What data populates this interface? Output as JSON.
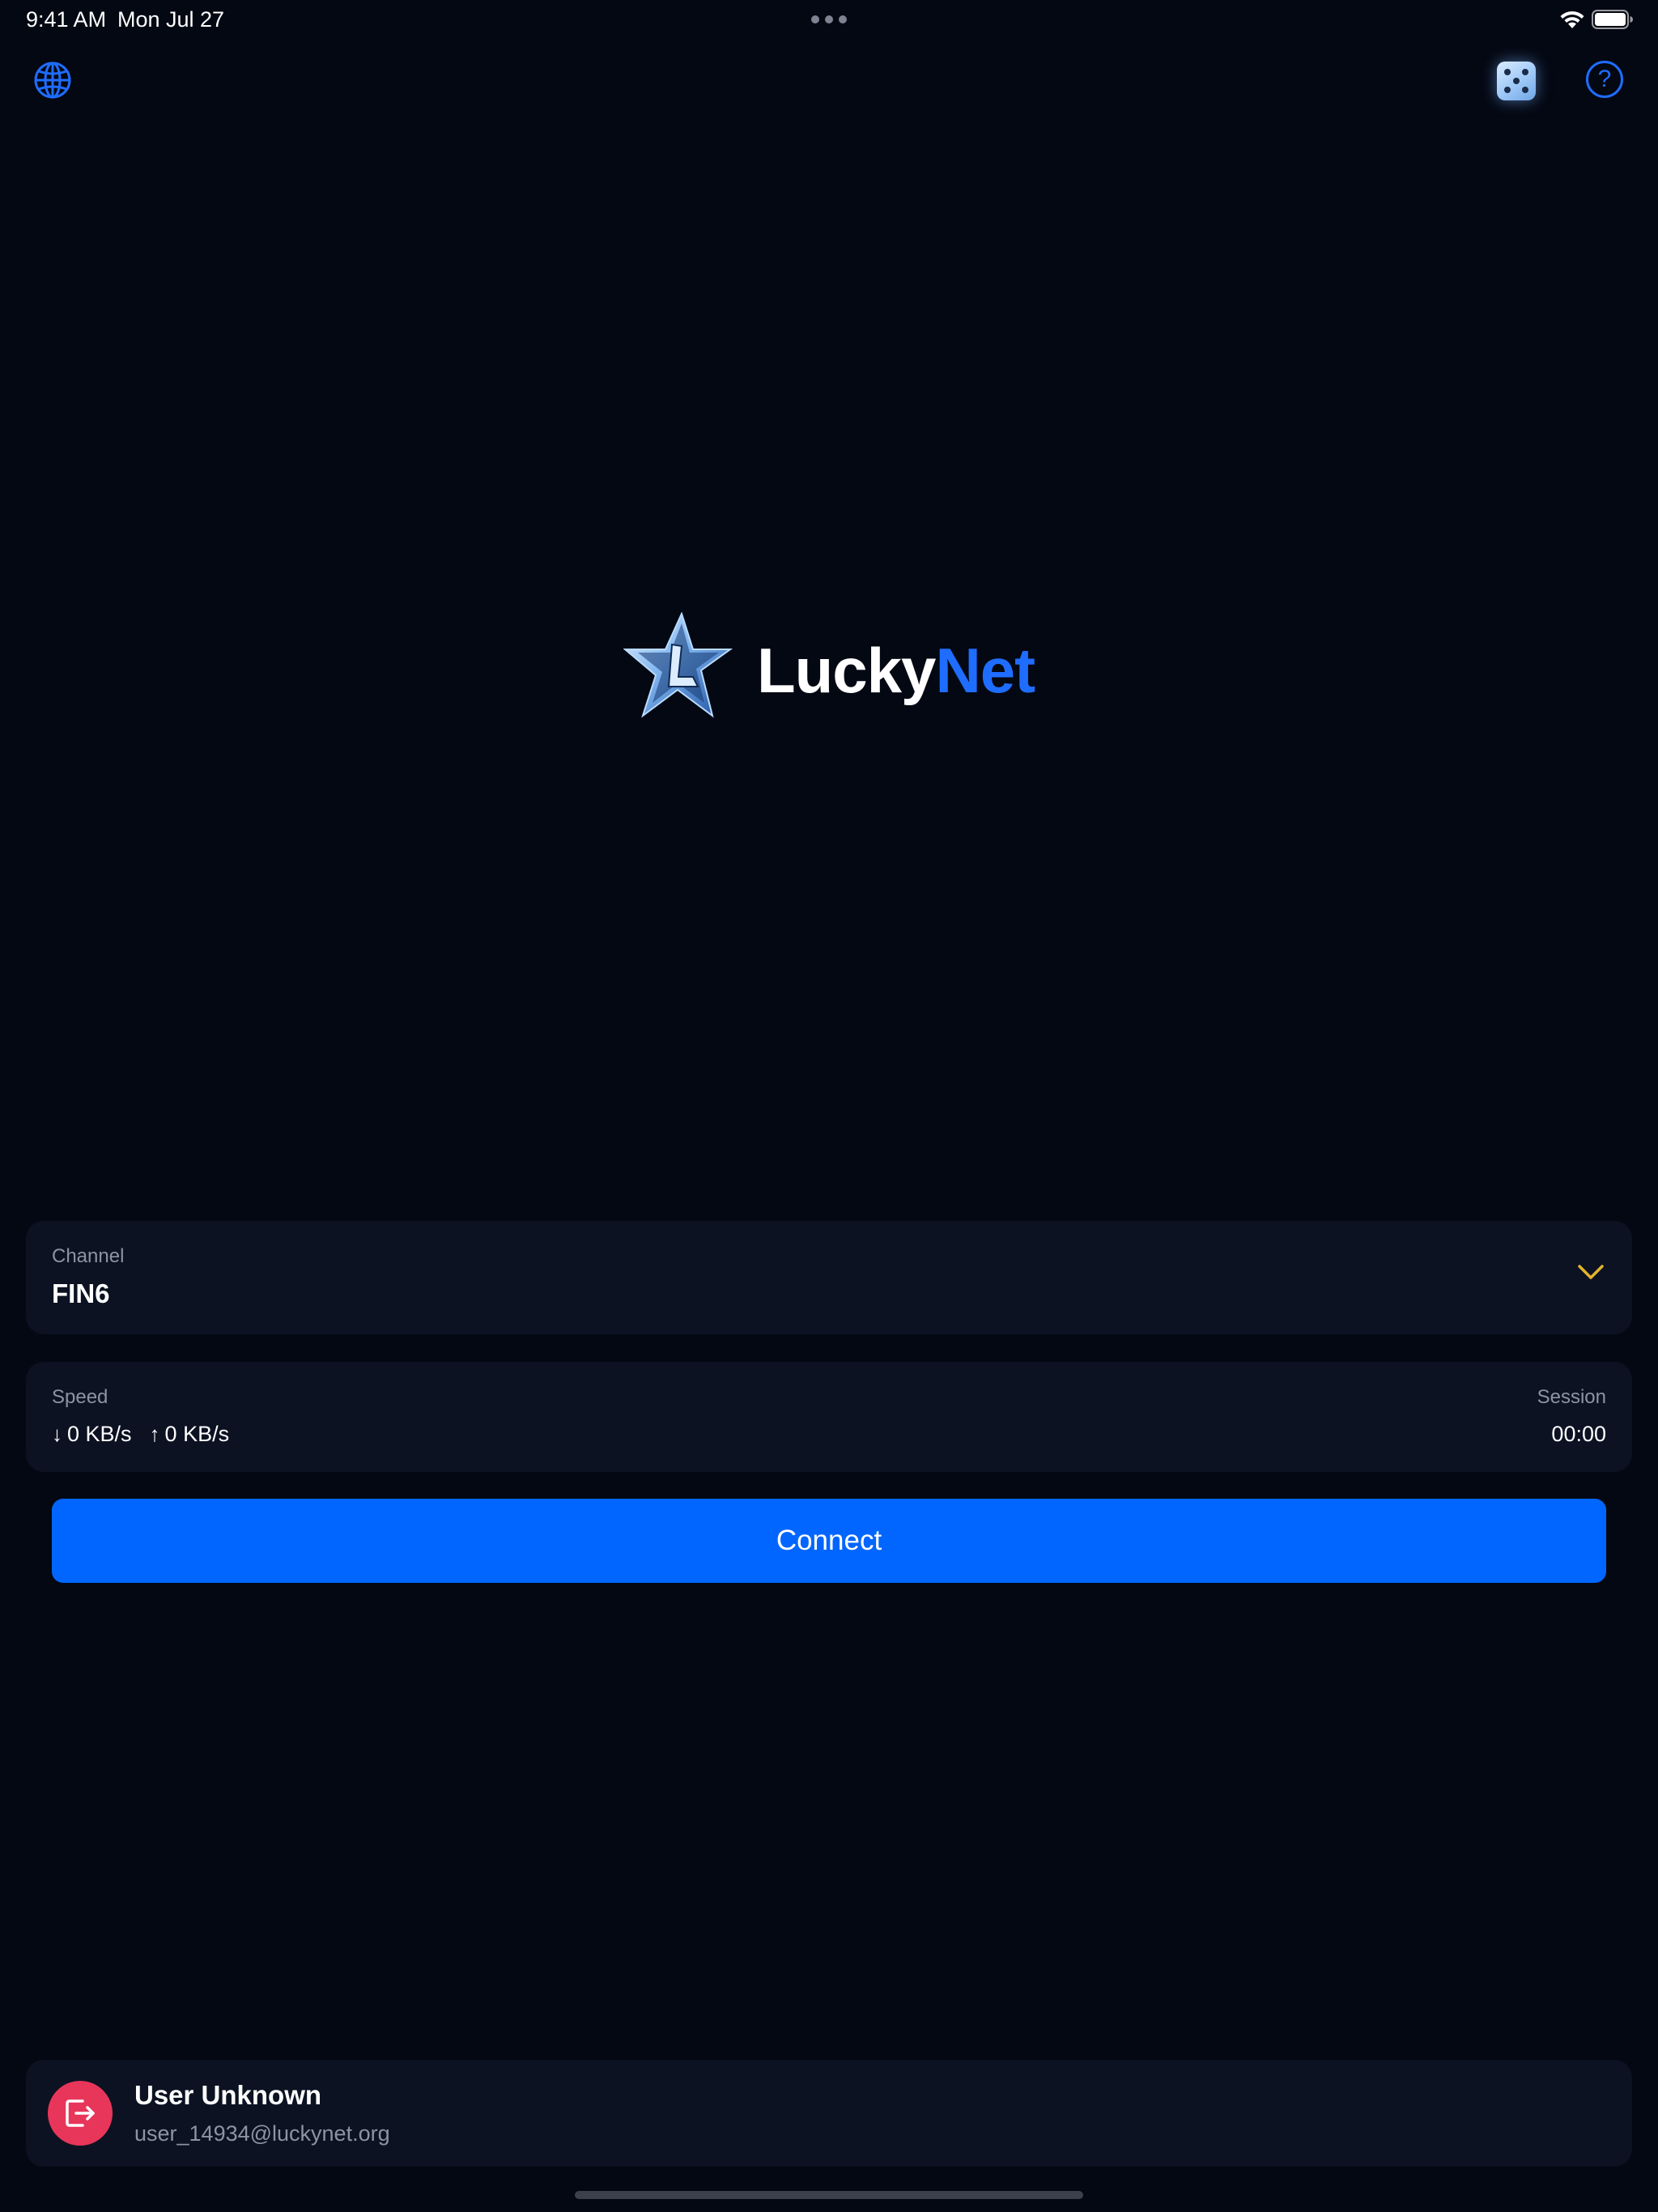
{
  "status_bar": {
    "time": "9:41 AM",
    "date": "Mon Jul 27",
    "multitask_icon": "ellipsis-icon",
    "wifi_icon": "wifi-icon",
    "battery_icon": "battery-icon"
  },
  "top_bar": {
    "left_icon": "globe-icon",
    "dice_icon": "dice-icon",
    "help_icon": "help-icon",
    "help_glyph": "?"
  },
  "brand": {
    "logo_icon": "star-logo-icon",
    "name_part1": "Lucky",
    "name_part2": "Net",
    "accent_color": "#1f6dff"
  },
  "channel": {
    "label": "Channel",
    "value": "FIN6",
    "dropdown_icon": "chevron-down-icon",
    "dropdown_color": "#e5b32b"
  },
  "stats": {
    "speed_label": "Speed",
    "download_arrow": "↓",
    "download": "0 KB/s",
    "upload_arrow": "↑",
    "upload": "0 KB/s",
    "session_label": "Session",
    "session_time": "00:00"
  },
  "connect": {
    "label": "Connect",
    "color": "#0066ff"
  },
  "user": {
    "name": "User Unknown",
    "email": "user_14934@luckynet.org",
    "logout_icon": "logout-icon",
    "logout_color": "#e8365a"
  }
}
